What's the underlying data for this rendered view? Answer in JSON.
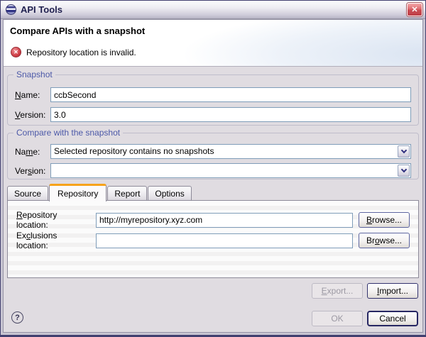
{
  "window": {
    "title": "API Tools"
  },
  "icons": {
    "close": "✕",
    "error": "✕",
    "help": "?"
  },
  "header": {
    "title": "Compare APIs with a snapshot",
    "error_message": "Repository location is invalid."
  },
  "snapshot_group": {
    "title": "Snapshot",
    "name_label": {
      "pre": "",
      "mn": "N",
      "post": "ame:"
    },
    "name_value": "ccbSecond",
    "version_label": {
      "pre": "",
      "mn": "V",
      "post": "ersion:"
    },
    "version_value": "3.0"
  },
  "compare_group": {
    "title": "Compare with the snapshot",
    "name_label": {
      "pre": "Na",
      "mn": "m",
      "post": "e:"
    },
    "name_value": "Selected repository contains no snapshots",
    "version_label": {
      "pre": "Ver",
      "mn": "s",
      "post": "ion:"
    },
    "version_value": ""
  },
  "tabs": [
    {
      "label": "Source"
    },
    {
      "label": "Repository"
    },
    {
      "label": "Report"
    },
    {
      "label": "Options"
    }
  ],
  "repository_tab": {
    "location_label": {
      "pre": "",
      "mn": "R",
      "post": "epository location:"
    },
    "location_value": "http://myrepository.xyz.com",
    "browse_location": {
      "pre": "",
      "mn": "B",
      "post": "rowse..."
    },
    "exclusions_label": {
      "pre": "Ex",
      "mn": "c",
      "post": "lusions location:"
    },
    "exclusions_value": "",
    "browse_exclusions": {
      "pre": "Br",
      "mn": "o",
      "post": "wse..."
    }
  },
  "actions": {
    "export": {
      "pre": "",
      "mn": "E",
      "post": "xport..."
    },
    "import": {
      "pre": "",
      "mn": "I",
      "post": "mport..."
    },
    "ok": "OK",
    "cancel": "Cancel"
  },
  "colors": {
    "accent_orange": "#F7A31B",
    "error_red": "#C8323E",
    "group_title_blue": "#4C59A8",
    "dialog_bg": "#E0DCE1",
    "frame_silver": "#C8C5D2",
    "input_border": "#7F9DB9"
  }
}
